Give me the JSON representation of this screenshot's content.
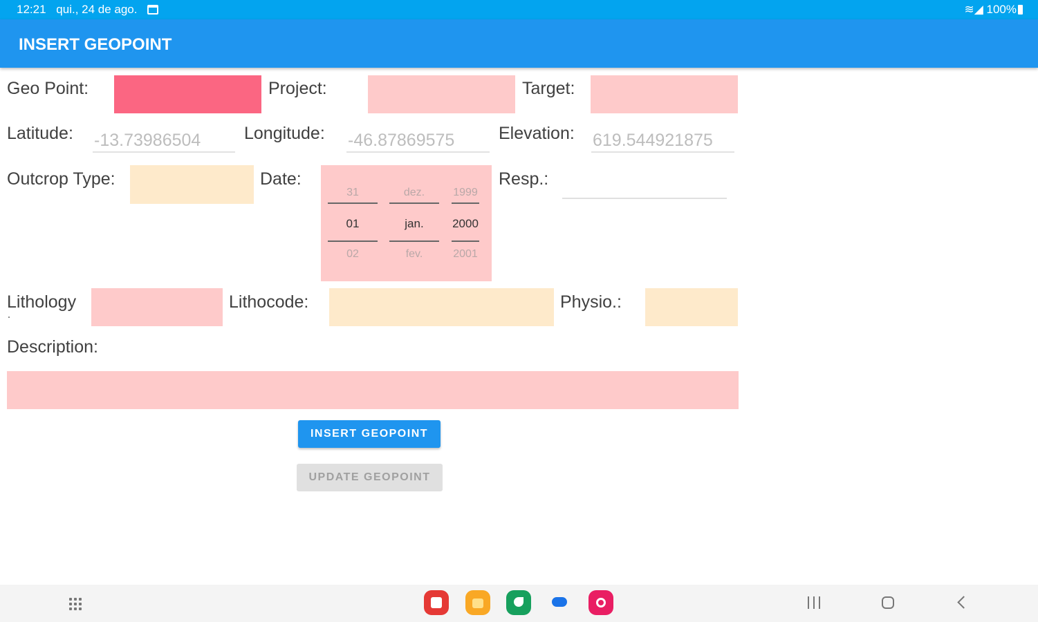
{
  "status_bar": {
    "time": "12:21",
    "date": "qui., 24 de ago.",
    "battery": "100%",
    "icons": [
      "calendar-icon",
      "wifi-icon",
      "signal-icon",
      "battery-icon"
    ]
  },
  "app_bar": {
    "title": "INSERT GEOPOINT"
  },
  "form": {
    "geo_point_label": "Geo Point:",
    "project_label": "Project:",
    "target_label": "Target:",
    "latitude_label": "Latitude:",
    "latitude_hint": "-13.73986504",
    "longitude_label": "Longitude:",
    "longitude_hint": "-46.87869575",
    "elevation_label": "Elevation:",
    "elevation_hint": "619.544921875",
    "outcrop_label": "Outcrop Type:",
    "date_label": "Date:",
    "resp_label": "Resp.:",
    "lithology_label": "Lithology",
    "lithology_sub": "·",
    "lithocode_label": "Lithocode:",
    "physio_label": "Physio.:",
    "description_label": "Description:"
  },
  "date_picker": {
    "day": {
      "prev": "31",
      "current": "01",
      "next": "02"
    },
    "month": {
      "prev": "dez.",
      "current": "jan.",
      "next": "fev."
    },
    "year": {
      "prev": "1999",
      "current": "2000",
      "next": "2001"
    }
  },
  "buttons": {
    "insert": "INSERT GEOPOINT",
    "update": "UPDATE GEOPOINT"
  },
  "colors": {
    "status_bar": "#03a4ef",
    "app_bar": "#1f95ef",
    "field_pink": "#fecaca",
    "field_hot_pink": "#fb6682",
    "field_beige": "#feeacb"
  },
  "nav_bar": {
    "icons": [
      "apps-grid-icon",
      "notes-app-icon",
      "files-app-icon",
      "phone-app-icon",
      "messages-app-icon",
      "screen-recorder-app-icon",
      "recent-apps-icon",
      "home-icon",
      "back-icon"
    ]
  }
}
